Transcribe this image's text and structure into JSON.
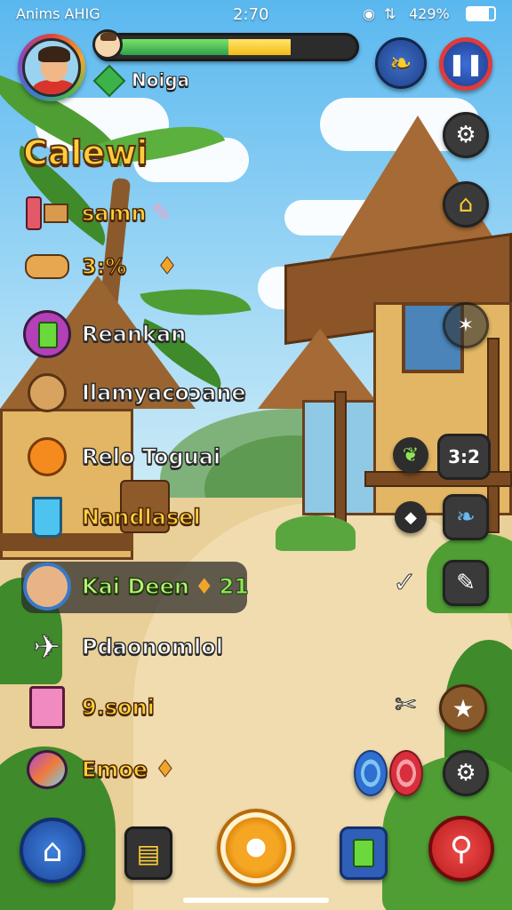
{
  "status_bar": {
    "carrier": "Anims AHIG",
    "time": "2:70",
    "battery": "429%"
  },
  "hud": {
    "currency_label": "Noiga",
    "progress_percent": 64
  },
  "menu": {
    "title": "Calewi",
    "items": [
      {
        "label": "samn",
        "style": "yellow",
        "icon": "bottle-icon"
      },
      {
        "label": "3:%",
        "style": "yellow",
        "icon": "bread-icon"
      },
      {
        "label": "Reankan",
        "style": "white",
        "icon": "green-cup-icon"
      },
      {
        "label": "Ilamyacoɔane",
        "style": "white",
        "icon": "monkey-icon"
      },
      {
        "label": "Relo Toguai",
        "style": "white",
        "icon": "orange-fruit-icon"
      },
      {
        "label": "Nandlasel",
        "style": "yellow",
        "icon": "drink-glass-icon"
      },
      {
        "label": "Kai Deen",
        "style": "green",
        "icon": "character-avatar-icon",
        "extra": "21"
      },
      {
        "label": "Pdaonomlol",
        "style": "white",
        "icon": "kite-icon"
      },
      {
        "label": "9.soni",
        "style": "yellow",
        "icon": "gift-bag-icon"
      },
      {
        "label": "Emoe",
        "style": "yellow",
        "icon": "candy-icon"
      }
    ]
  },
  "right_panel": {
    "counter": "3:2"
  },
  "bottom_nav": [
    "home",
    "fries",
    "center-coin",
    "green-cup",
    "search"
  ],
  "colors": {
    "accent_yellow": "#ffd23b",
    "outline": "#4a2608",
    "sky": "#5ab8ef",
    "sand": "#f0dcae"
  }
}
